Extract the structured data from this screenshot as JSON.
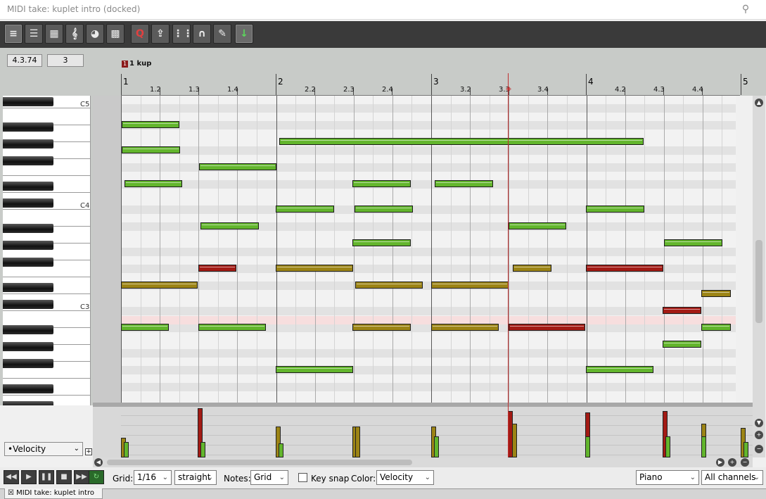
{
  "window": {
    "title": "MIDI take: kuplet intro (docked)"
  },
  "toolbar": {
    "buttons": [
      {
        "name": "piano-roll-mode-button",
        "label": "≡"
      },
      {
        "name": "named-notes-mode-button",
        "label": "☰"
      },
      {
        "name": "event-list-mode-button",
        "label": "▦"
      },
      {
        "name": "notation-mode-button",
        "label": "𝄞"
      },
      {
        "name": "color-notes-button",
        "label": "◕"
      },
      {
        "name": "grid-view-button",
        "label": "▩"
      },
      {
        "name": "quantize-button",
        "label": "Q"
      },
      {
        "name": "step-input-button",
        "label": "⇪"
      },
      {
        "name": "show-grid-button",
        "label": "⋮⋮"
      },
      {
        "name": "snap-button",
        "label": "∩"
      },
      {
        "name": "note-color-palette-button",
        "label": "✎"
      },
      {
        "name": "insert-mode-button",
        "label": "↓"
      }
    ]
  },
  "info": {
    "position": "4.3.74",
    "value": "3"
  },
  "region": {
    "marker_index": "1",
    "name": "1 kup"
  },
  "ruler": {
    "bars": [
      "1",
      "2",
      "3",
      "4",
      "5"
    ],
    "beats": [
      "1.2",
      "1.3",
      "1.4",
      "2.2",
      "2.3",
      "2.4",
      "3.2",
      "3.3",
      "3.4",
      "4.2",
      "4.3",
      "4.4"
    ]
  },
  "piano": {
    "labels": [
      "C5",
      "C4",
      "C3"
    ]
  },
  "cc": {
    "lane_label": "•Velocity",
    "add_label": "+"
  },
  "bottom": {
    "transport": [
      "◀◀",
      "▶",
      "❚❚",
      "■",
      "▶▶",
      "↻"
    ],
    "grid_label": "Grid:",
    "grid_value": "1/16",
    "grid_type": "straight",
    "notes_label": "Notes:",
    "notes_value": "Grid",
    "key_snap_label": "Key snap",
    "color_label": "Color:",
    "color_value": "Velocity",
    "instrument": "Piano",
    "channels": "All channels"
  },
  "tab": {
    "label": "MIDI take: kuplet intro"
  },
  "colors": {
    "green": "#62b52c",
    "olive": "#9c8415",
    "red": "#a31a14",
    "lightgreen": "#7ec840"
  }
}
